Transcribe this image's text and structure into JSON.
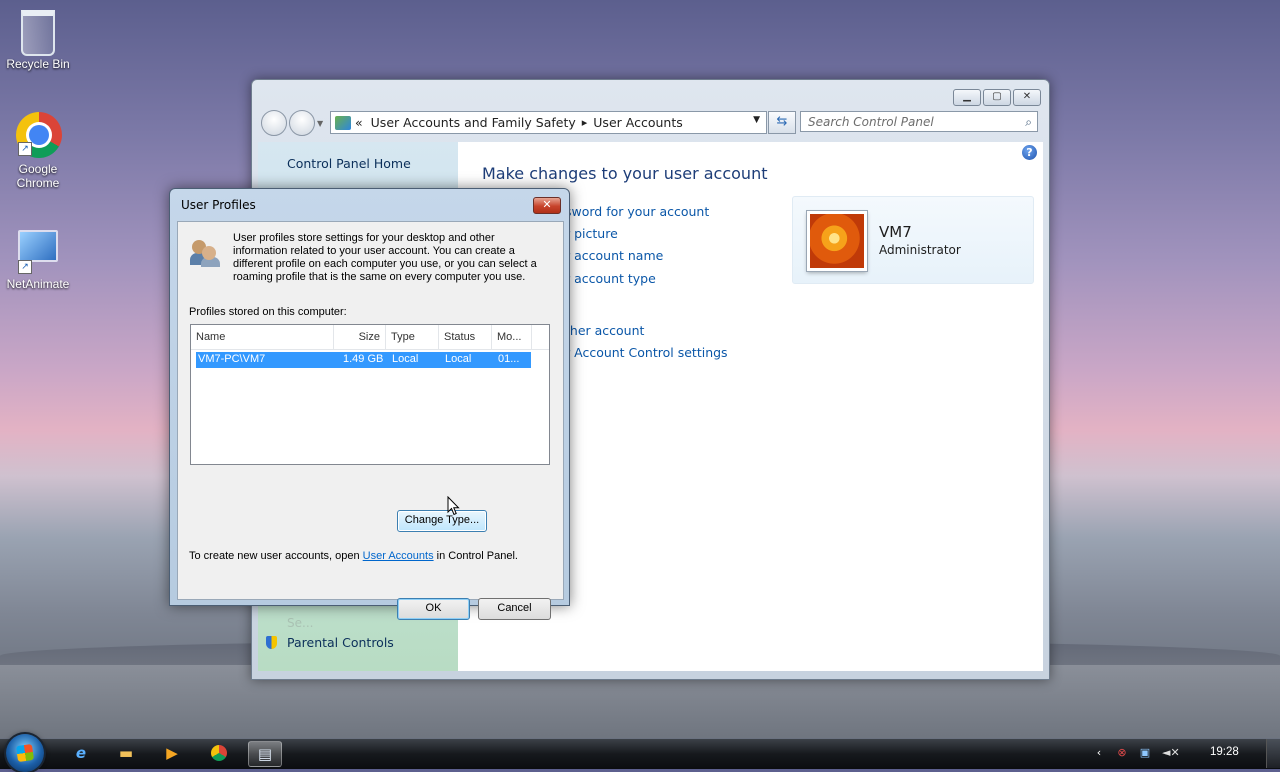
{
  "desktop": {
    "icons": [
      {
        "label": "Recycle Bin",
        "icon": "recycle-bin-icon"
      },
      {
        "label": "Google Chrome",
        "icon": "chrome-icon"
      },
      {
        "label": "NetAnimate",
        "icon": "netanimate-icon"
      }
    ]
  },
  "control_panel": {
    "breadcrumb": {
      "chevrons": "«",
      "parent": "User Accounts and Family Safety",
      "separator": "▸",
      "current": "User Accounts"
    },
    "search_placeholder": "Search Control Panel",
    "left": {
      "home": "Control Panel Home",
      "faded_item": "Se...",
      "parental": "Parental Controls"
    },
    "heading": "Make changes to your user account",
    "links": [
      "sword for your account",
      "r picture",
      "r account name",
      "r account type",
      "ther account",
      "r Account Control settings"
    ],
    "user": {
      "name": "VM7",
      "role": "Administrator"
    },
    "help": "?"
  },
  "dialog": {
    "title": "User Profiles",
    "close": "✕",
    "description": "User profiles store settings for your desktop and other information related to your user account. You can create a different profile on each computer you use, or you can select a roaming profile that is the same on every computer you use.",
    "stored_label": "Profiles stored on this computer:",
    "columns": [
      "Name",
      "Size",
      "Type",
      "Status",
      "Mo..."
    ],
    "rows": [
      {
        "name": "VM7-PC\\VM7",
        "size": "1.49 GB",
        "type": "Local",
        "status": "Local",
        "modified": "01..."
      }
    ],
    "change_type": "Change Type...",
    "note_prefix": "To create new user accounts, open ",
    "note_link": "User Accounts",
    "note_suffix": " in Control Panel.",
    "ok": "OK",
    "cancel": "Cancel"
  },
  "taskbar": {
    "apps": [
      "internet-explorer-icon",
      "folder-icon",
      "media-player-icon",
      "chrome-icon",
      "control-panel-icon"
    ],
    "clock": "19:28"
  }
}
